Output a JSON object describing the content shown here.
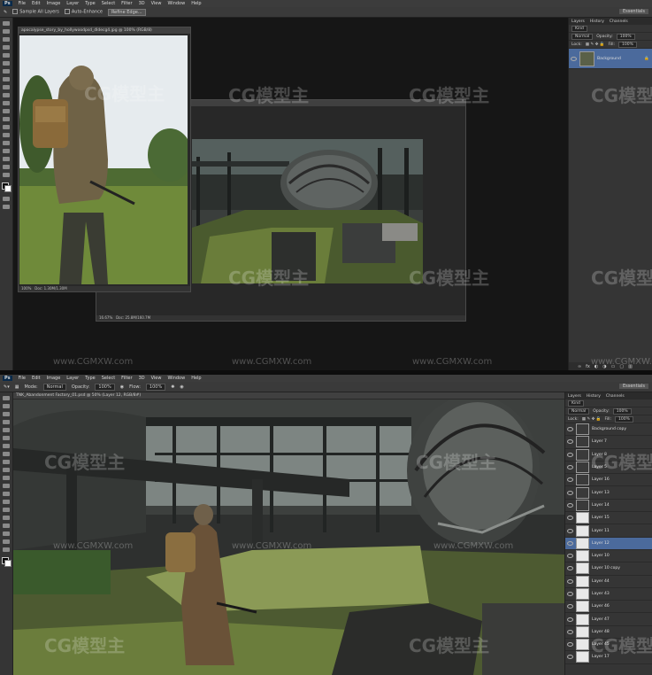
{
  "app": {
    "logo": "Ps"
  },
  "top": {
    "menu": [
      "File",
      "Edit",
      "Image",
      "Layer",
      "Type",
      "Select",
      "Filter",
      "3D",
      "View",
      "Window",
      "Help"
    ],
    "options": {
      "sample_all_layers": "Sample All Layers",
      "auto_enhance": "Auto-Enhance",
      "refine_edge": "Refine Edge..."
    },
    "workspace": "Essentials",
    "doc1": {
      "title": "apocalypse_story_by_hollywoodpsd_dldecg4.jpg @ 100% (RGB/8)",
      "zoom": "100%",
      "doc_size": "Doc: 1.30M/1.30M"
    },
    "doc2": {
      "title": "",
      "zoom": "16.67%",
      "doc_size": "Doc: 25.8M/160.7M"
    },
    "panel": {
      "tabs": [
        "Layers",
        "History",
        "Channels"
      ],
      "kind": "Kind",
      "mode": "Normal",
      "opacity_label": "Opacity:",
      "opacity": "100%",
      "lock_label": "Lock:",
      "fill_label": "Fill:",
      "fill": "100%",
      "layer": "Background"
    }
  },
  "bottom": {
    "menu": [
      "File",
      "Edit",
      "Image",
      "Layer",
      "Type",
      "Select",
      "Filter",
      "3D",
      "View",
      "Window",
      "Help"
    ],
    "options": {
      "mode_label": "Mode:",
      "mode": "Normal",
      "opacity_label": "Opacity:",
      "opacity": "100%",
      "flow_label": "Flow:",
      "flow": "100%"
    },
    "workspace": "Essentials",
    "doc": {
      "title": "TNK_Abandonment Factory_01.psd @ 50% (Layer 12, RGB/8#)"
    },
    "panel": {
      "tabs": [
        "Layers",
        "History",
        "Channels"
      ],
      "kind": "Kind",
      "mode": "Normal",
      "opacity_label": "Opacity:",
      "opacity": "100%",
      "lock_label": "Lock:",
      "fill_label": "Fill:",
      "fill": "100%",
      "layers": [
        "Background copy",
        "Layer 7",
        "Layer 8",
        "Layer 5",
        "Layer 16",
        "Layer 13",
        "Layer 14",
        "Layer 15",
        "Layer 11",
        "Layer 12",
        "Layer 10",
        "Layer 10 copy",
        "Layer 44",
        "Layer 43",
        "Layer 46",
        "Layer 47",
        "Layer 48",
        "Layer 45",
        "Layer 17"
      ]
    }
  },
  "watermark": {
    "logo": "CG模型主",
    "url": "www.CGMXW.com"
  }
}
